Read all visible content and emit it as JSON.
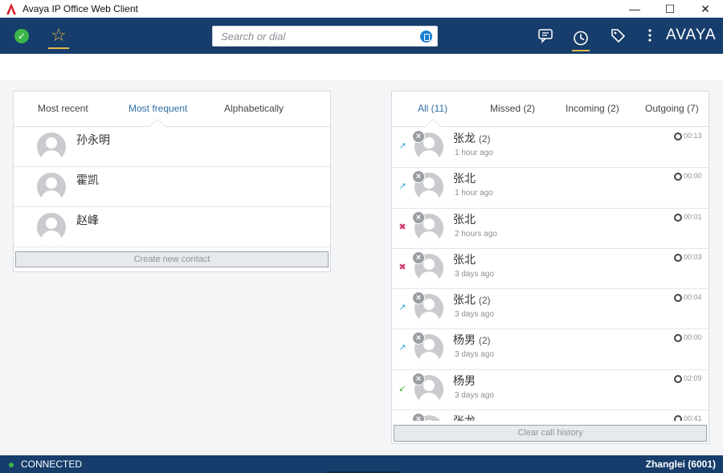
{
  "window": {
    "title": "Avaya IP Office Web Client",
    "controls": {
      "minimize": "—",
      "maximize": "☐",
      "close": "✕"
    }
  },
  "topnav": {
    "status_icon": "check-circle-icon",
    "status_color": "#3bb54a",
    "favorites_icon": "star-icon",
    "search": {
      "placeholder": "Search or dial",
      "value": ""
    },
    "icons": [
      "chat-icon",
      "clock-history-icon",
      "tag-icon",
      "more-vert-icon"
    ],
    "logo": "AVAYA",
    "accent": "#e8b84a",
    "bar_color": "#163d6b"
  },
  "contacts": {
    "tabs": [
      {
        "label": "Most recent",
        "active": false
      },
      {
        "label": "Most frequent",
        "active": true
      },
      {
        "label": "Alphabetically",
        "active": false
      }
    ],
    "items": [
      {
        "name": "孙永明"
      },
      {
        "name": "霍凯"
      },
      {
        "name": "赵峰"
      }
    ],
    "create_label": "Create new contact"
  },
  "calls": {
    "tabs": [
      {
        "label": "All (11)",
        "active": true
      },
      {
        "label": "Missed (2)",
        "active": false
      },
      {
        "label": "Incoming (2)",
        "active": false
      },
      {
        "label": "Outgoing (7)",
        "active": false
      }
    ],
    "items": [
      {
        "name": "张龙",
        "count": "(2)",
        "time": "1 hour ago",
        "duration": "00:13",
        "direction": "outgoing"
      },
      {
        "name": "张北",
        "count": "",
        "time": "1 hour ago",
        "duration": "00:00",
        "direction": "outgoing"
      },
      {
        "name": "张北",
        "count": "",
        "time": "2 hours ago",
        "duration": "00:01",
        "direction": "missed"
      },
      {
        "name": "张北",
        "count": "",
        "time": "3 days ago",
        "duration": "00:03",
        "direction": "missed"
      },
      {
        "name": "张北",
        "count": "(2)",
        "time": "3 days ago",
        "duration": "00:04",
        "direction": "outgoing"
      },
      {
        "name": "杨男",
        "count": "(2)",
        "time": "3 days ago",
        "duration": "00:00",
        "direction": "outgoing"
      },
      {
        "name": "杨男",
        "count": "",
        "time": "3 days ago",
        "duration": "02:09",
        "direction": "incoming"
      },
      {
        "name": "张龙",
        "count": "",
        "time": "",
        "duration": "00:41",
        "direction": "outgoing"
      }
    ],
    "clear_label": "Clear call history"
  },
  "statusbar": {
    "connection": "CONNECTED",
    "user": "Zhanglei (6001)"
  }
}
